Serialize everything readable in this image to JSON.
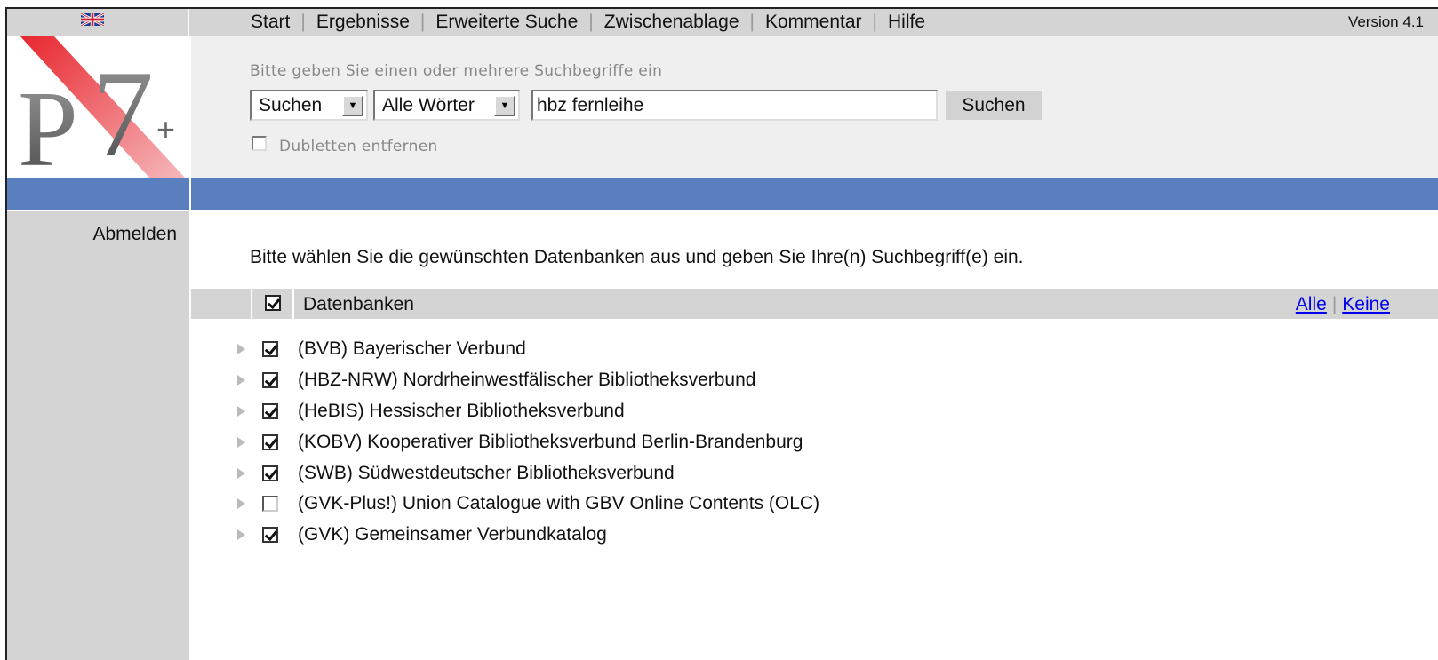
{
  "nav": {
    "items": [
      "Start",
      "Ergebnisse",
      "Erweiterte Suche",
      "Zwischenablage",
      "Kommentar",
      "Hilfe"
    ],
    "version": "Version 4.1"
  },
  "icons": {
    "flag": "uk-flag-icon",
    "logo": "p7-plus-logo"
  },
  "colors": {
    "accent_band": "#5a7fbe",
    "panel_gray": "#d4d4d4",
    "link": "#0000ee",
    "logo_red": "#e8262e"
  },
  "search": {
    "hint": "Bitte geben Sie einen oder mehrere Suchbegriffe ein",
    "mode_selected": "Suchen",
    "words_selected": "Alle Wörter",
    "query": "hbz fernleihe",
    "button": "Suchen",
    "dedup_label": "Dubletten entfernen",
    "dedup_checked": false
  },
  "sidebar": {
    "logout": "Abmelden"
  },
  "main": {
    "instruction": "Bitte wählen Sie die gewünschten Datenbanken aus und geben Sie Ihre(n) Suchbegriff(e) ein.",
    "databases_header": "Datenbanken",
    "select_all": "Alle",
    "select_none": "Keine",
    "databases": [
      {
        "label": "(BVB) Bayerischer Verbund",
        "checked": true
      },
      {
        "label": "(HBZ-NRW) Nordrheinwestfälischer Bibliotheksverbund",
        "checked": true
      },
      {
        "label": "(HeBIS) Hessischer Bibliotheksverbund",
        "checked": true
      },
      {
        "label": "(KOBV) Kooperativer Bibliotheksverbund Berlin-Brandenburg",
        "checked": true
      },
      {
        "label": "(SWB) Südwestdeutscher Bibliotheksverbund",
        "checked": true
      },
      {
        "label": "(GVK-Plus!) Union Catalogue with GBV Online Contents (OLC)",
        "checked": false
      },
      {
        "label": "(GVK) Gemeinsamer Verbundkatalog",
        "checked": true
      }
    ]
  }
}
